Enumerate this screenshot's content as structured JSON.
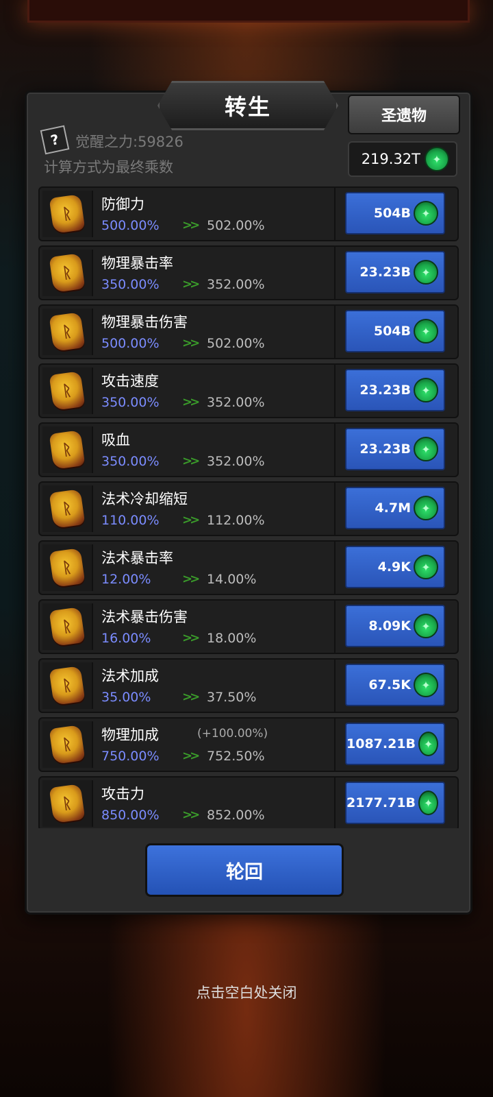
{
  "title": "转生",
  "relic_button": "圣遗物",
  "currency": {
    "amount": "219.32T",
    "icon": "green-soul-icon"
  },
  "help_icon": "?",
  "awaken_power": "觉醒之力:59826",
  "calc_note": "计算方式为最终乘数",
  "arrows": ">>",
  "upgrades": [
    {
      "name": "防御力",
      "current": "500.00%",
      "next": "502.00%",
      "cost": "504B"
    },
    {
      "name": "物理暴击率",
      "current": "350.00%",
      "next": "352.00%",
      "cost": "23.23B"
    },
    {
      "name": "物理暴击伤害",
      "current": "500.00%",
      "next": "502.00%",
      "cost": "504B"
    },
    {
      "name": "攻击速度",
      "current": "350.00%",
      "next": "352.00%",
      "cost": "23.23B"
    },
    {
      "name": "吸血",
      "current": "350.00%",
      "next": "352.00%",
      "cost": "23.23B"
    },
    {
      "name": "法术冷却缩短",
      "current": "110.00%",
      "next": "112.00%",
      "cost": "4.7M"
    },
    {
      "name": "法术暴击率",
      "current": "12.00%",
      "next": "14.00%",
      "cost": "4.9K"
    },
    {
      "name": "法术暴击伤害",
      "current": "16.00%",
      "next": "18.00%",
      "cost": "8.09K"
    },
    {
      "name": "法术加成",
      "current": "35.00%",
      "next": "37.50%",
      "cost": "67.5K"
    },
    {
      "name": "物理加成",
      "bonus": "(+100.00%)",
      "current": "750.00%",
      "next": "752.50%",
      "cost": "1087.21B"
    },
    {
      "name": "攻击力",
      "current": "850.00%",
      "next": "852.00%",
      "cost": "2177.71B"
    }
  ],
  "rebirth_button": "轮回",
  "close_hint": "点击空白处关闭",
  "colors": {
    "accent_blue": "#2f5fcc",
    "current_value": "#7b8cff",
    "arrow_green": "#3a9a2a"
  }
}
